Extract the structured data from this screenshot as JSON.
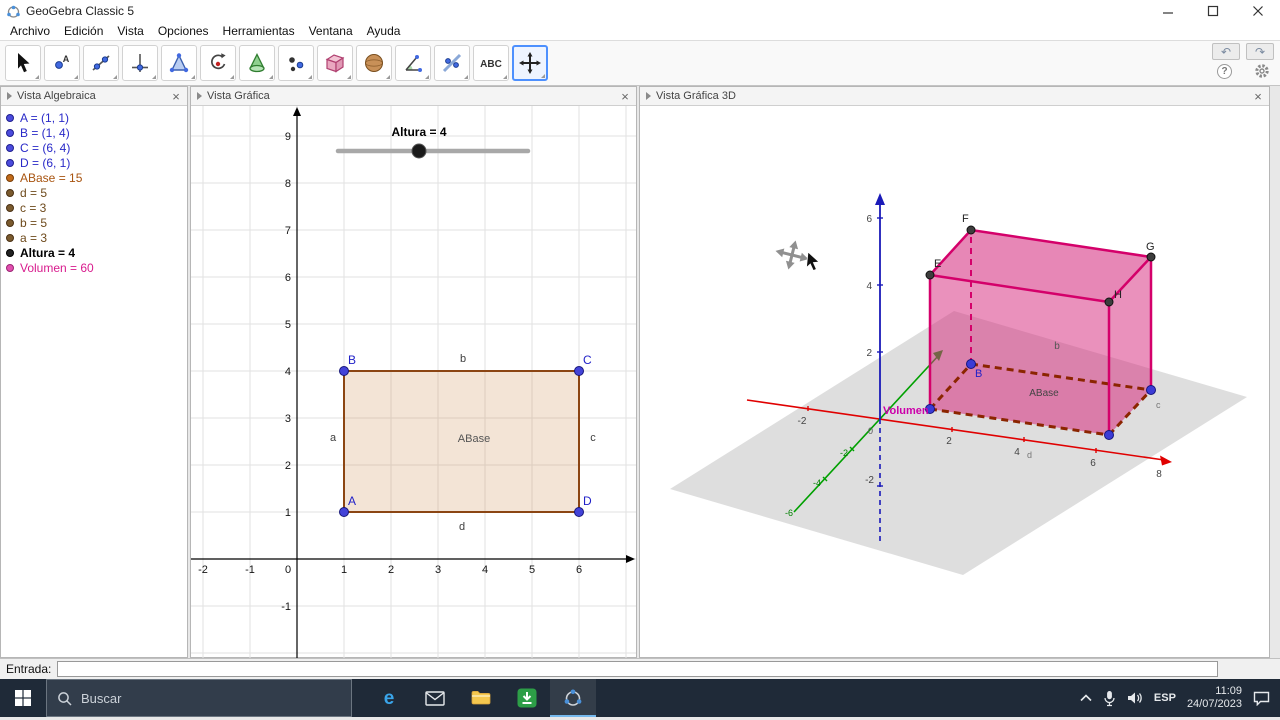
{
  "window": {
    "title": "GeoGebra Classic 5"
  },
  "menu": {
    "items": [
      "Archivo",
      "Edición",
      "Vista",
      "Opciones",
      "Herramientas",
      "Ventana",
      "Ayuda"
    ]
  },
  "toolbar": {
    "tools": [
      "move",
      "point",
      "line",
      "perpendicular-line",
      "polygon",
      "rotate-around-point",
      "cone",
      "point-tools",
      "prism",
      "sphere",
      "angle",
      "reflect-about-line",
      "text",
      "move-graphics-view"
    ],
    "selected_tool": "move-graphics-view",
    "text_tool_label": "ABC",
    "point_tool_letter": "A"
  },
  "panels": {
    "algebra": {
      "title": "Vista Algebraica",
      "items": [
        {
          "label": "A = (1, 1)"
        },
        {
          "label": "B = (1, 4)"
        },
        {
          "label": "C = (6, 4)"
        },
        {
          "label": "D = (6, 1)"
        },
        {
          "label": "ABase = 15"
        },
        {
          "label": "d = 5"
        },
        {
          "label": "c = 3"
        },
        {
          "label": "b = 5"
        },
        {
          "label": "a = 3"
        },
        {
          "label": "Altura = 4"
        },
        {
          "label": "Volumen = 60"
        }
      ]
    },
    "graphics": {
      "title": "Vista Gráfica",
      "slider_label": "Altura = 4",
      "xticks": [
        "-2",
        "-1",
        "0",
        "1",
        "2",
        "3",
        "4",
        "5",
        "6"
      ],
      "yticks": [
        "9",
        "8",
        "7",
        "6",
        "5",
        "4",
        "3",
        "2",
        "1",
        "-1"
      ],
      "vertices": {
        "A": "A",
        "B": "B",
        "C": "C",
        "D": "D"
      },
      "sides": {
        "a": "a",
        "b": "b",
        "c": "c",
        "d": "d"
      },
      "area_label": "ABase"
    },
    "graphics3d": {
      "title": "Vista Gráfica 3D",
      "xticks": [
        "-2",
        "2",
        "4",
        "6",
        "8"
      ],
      "zticks": [
        "6",
        "4",
        "2",
        "-2"
      ],
      "yticks": [
        "-2",
        "-4",
        "-6"
      ],
      "origin_label": "0",
      "points": {
        "B": "B",
        "E": "E",
        "F": "F",
        "G": "G",
        "H": "H"
      },
      "labels": {
        "volume": "Volumen",
        "area": "ABase",
        "b": "b",
        "c": "c",
        "d": "d"
      }
    }
  },
  "input": {
    "label": "Entrada:"
  },
  "taskbar": {
    "search_placeholder": "Buscar",
    "tray": {
      "language": "ESP",
      "time": "11:09",
      "date": "24/07/2023"
    }
  },
  "icons": {
    "close_glyph": "×",
    "undo_glyph": "↶",
    "redo_glyph": "↷",
    "help_glyph": "?",
    "edge_glyph": "e"
  },
  "colors": {
    "point_blue": "#2929c8",
    "polygon_brown": "#a85410",
    "segment_brown": "#6e4a1c",
    "volume_magenta": "#d81b8d",
    "prism_pink": "#d83282",
    "prism_edge": "#d4006a",
    "base_edge": "#8b2500",
    "rect_fill": "#c98544",
    "rect_border": "#8b4513",
    "axis_x_red": "#e00000",
    "axis_y_green": "#00a000",
    "axis_z_blue": "#1a1ab8",
    "selected_tool_border": "#4d90fe",
    "taskbar_bg": "#1f2a38"
  }
}
